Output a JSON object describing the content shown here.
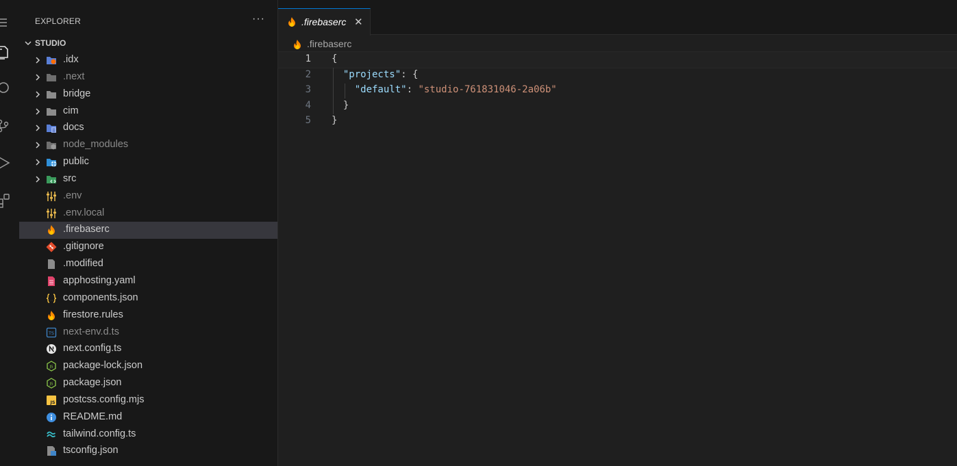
{
  "explorer": {
    "title": "EXPLORER",
    "more": "···",
    "root": "STUDIO",
    "items": [
      {
        "name": ".idx",
        "type": "folder",
        "icon": "idx-folder-icon",
        "dim": false
      },
      {
        "name": ".next",
        "type": "folder",
        "icon": "folder-icon",
        "dim": true
      },
      {
        "name": "bridge",
        "type": "folder",
        "icon": "folder-icon",
        "dim": false
      },
      {
        "name": "cim",
        "type": "folder",
        "icon": "folder-icon",
        "dim": false
      },
      {
        "name": "docs",
        "type": "folder",
        "icon": "docs-folder-icon",
        "dim": false
      },
      {
        "name": "node_modules",
        "type": "folder",
        "icon": "node-modules-folder-icon",
        "dim": true
      },
      {
        "name": "public",
        "type": "folder",
        "icon": "public-folder-icon",
        "dim": false
      },
      {
        "name": "src",
        "type": "folder",
        "icon": "src-folder-icon",
        "dim": false
      },
      {
        "name": ".env",
        "type": "file",
        "icon": "env-icon",
        "dim": true
      },
      {
        "name": ".env.local",
        "type": "file",
        "icon": "env-icon",
        "dim": true
      },
      {
        "name": ".firebaserc",
        "type": "file",
        "icon": "firebase-icon",
        "dim": false,
        "selected": true
      },
      {
        "name": ".gitignore",
        "type": "file",
        "icon": "git-icon",
        "dim": false
      },
      {
        "name": ".modified",
        "type": "file",
        "icon": "file-icon",
        "dim": false
      },
      {
        "name": "apphosting.yaml",
        "type": "file",
        "icon": "yaml-icon",
        "dim": false
      },
      {
        "name": "components.json",
        "type": "file",
        "icon": "json-icon",
        "dim": false
      },
      {
        "name": "firestore.rules",
        "type": "file",
        "icon": "firebase-icon",
        "dim": false
      },
      {
        "name": "next-env.d.ts",
        "type": "file",
        "icon": "typescript-def-icon",
        "dim": true
      },
      {
        "name": "next.config.ts",
        "type": "file",
        "icon": "nextjs-icon",
        "dim": false
      },
      {
        "name": "package-lock.json",
        "type": "file",
        "icon": "nodejs-icon",
        "dim": false
      },
      {
        "name": "package.json",
        "type": "file",
        "icon": "nodejs-icon",
        "dim": false
      },
      {
        "name": "postcss.config.mjs",
        "type": "file",
        "icon": "javascript-icon",
        "dim": false
      },
      {
        "name": "README.md",
        "type": "file",
        "icon": "info-icon",
        "dim": false
      },
      {
        "name": "tailwind.config.ts",
        "type": "file",
        "icon": "tailwind-icon",
        "dim": false
      },
      {
        "name": "tsconfig.json",
        "type": "file",
        "icon": "tsconfig-icon",
        "dim": false
      }
    ]
  },
  "editor": {
    "tab": {
      "label": ".firebaserc",
      "close": "✕"
    },
    "breadcrumb": ".firebaserc",
    "lines": [
      {
        "n": "1",
        "text": "{"
      },
      {
        "n": "2",
        "text": "  \"projects\": {"
      },
      {
        "n": "3",
        "text": "    \"default\": \"studio-761831046-2a06b\""
      },
      {
        "n": "4",
        "text": "  }"
      },
      {
        "n": "5",
        "text": "}"
      }
    ]
  },
  "colors": {
    "accent": "#0078d4",
    "selection": "#37373d",
    "json_key": "#9cdcfe",
    "json_string": "#ce9178",
    "folder": "#8c8c8c",
    "firebase": "#ff8a00"
  }
}
